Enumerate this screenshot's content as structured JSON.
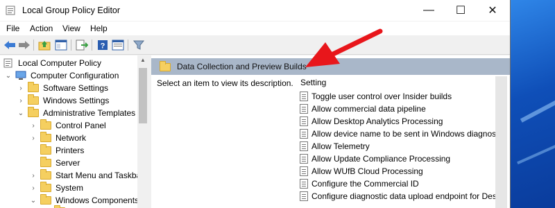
{
  "window": {
    "title": "Local Group Policy Editor"
  },
  "controls": {
    "minimize": "—",
    "maximize": "☐",
    "close": "✕"
  },
  "menu": [
    "File",
    "Action",
    "View",
    "Help"
  ],
  "tree": [
    {
      "label": "Local Computer Policy",
      "chevron": ""
    },
    {
      "label": "Computer Configuration",
      "chevron": "⌄"
    },
    {
      "label": "Software Settings",
      "chevron": "›"
    },
    {
      "label": "Windows Settings",
      "chevron": "›"
    },
    {
      "label": "Administrative Templates",
      "chevron": "⌄"
    },
    {
      "label": "Control Panel",
      "chevron": "›"
    },
    {
      "label": "Network",
      "chevron": "›"
    },
    {
      "label": "Printers",
      "chevron": ""
    },
    {
      "label": "Server",
      "chevron": ""
    },
    {
      "label": "Start Menu and Taskba",
      "chevron": "›"
    },
    {
      "label": "System",
      "chevron": "›"
    },
    {
      "label": "Windows Components",
      "chevron": "⌄"
    }
  ],
  "details": {
    "header": "Data Collection and Preview Builds",
    "description": "Select an item to view its description.",
    "column_header": "Setting",
    "settings": [
      "Toggle user control over Insider builds",
      "Allow commercial data pipeline",
      "Allow Desktop Analytics Processing",
      "Allow device name to be sent in Windows diagnostic",
      "Allow Telemetry",
      "Allow Update Compliance Processing",
      "Allow WUfB Cloud Processing",
      "Configure the Commercial ID",
      "Configure diagnostic data upload endpoint for Desk"
    ]
  },
  "colors": {
    "arrow": "#e8161b",
    "header_band": "#a9b7c9"
  }
}
